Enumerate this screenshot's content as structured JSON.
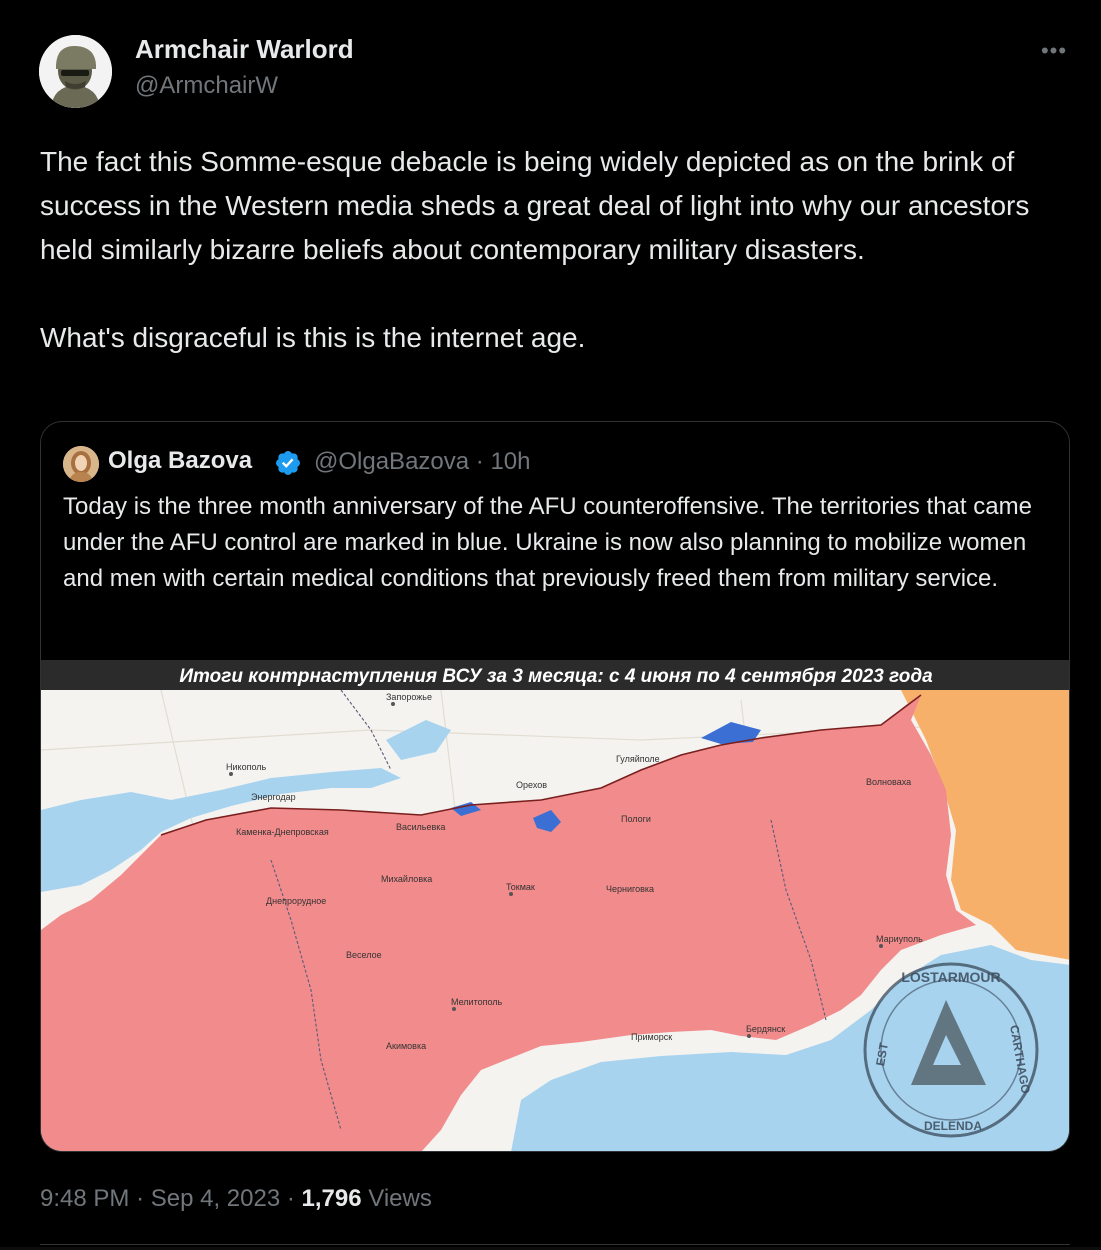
{
  "tweet": {
    "author_name": "Armchair Warlord",
    "author_handle": "@ArmchairW",
    "more_label": "•••",
    "paragraphs": [
      "The fact this Somme-esque debacle is being widely depicted as on the brink of success in the Western media sheds a great deal of light into why our ancestors held similarly bizarre beliefs about contemporary military disasters.",
      "What's disgraceful is this is the internet age."
    ],
    "time": "9:48 PM",
    "date": "Sep 4, 2023",
    "views_count": "1,796",
    "views_label": "Views",
    "sep": "·"
  },
  "quote": {
    "author_name": "Olga Bazova",
    "author_handle": "@OlgaBazova",
    "age": "10h",
    "text": "Today is the three month anniversary of the AFU counteroffensive. The territories that came under the AFU control are marked in blue. Ukraine is now also planning to mobilize women and men with certain medical conditions that previously freed them from military service.",
    "verified_color": "#1d9bf0"
  },
  "map": {
    "title": "Итоги контрнаступления ВСУ за 3 месяца: с 4 июня по 4 сентября 2023 года",
    "watermark_words": [
      "LOSTARMOUR",
      "CARTHAGO",
      "DELENDA",
      "EST"
    ],
    "cities": [
      "Запорожье",
      "Никополь",
      "Энергодар",
      "Васильевка",
      "Пологи",
      "Токмак",
      "Орехов",
      "Мелитополь",
      "Бердянск",
      "Мариуполь",
      "Волноваха",
      "Приморск",
      "Гуляйполе",
      "Каменка-Днепровская",
      "Михайловка",
      "Веселое",
      "Акимовка",
      "Днепрорудное",
      "Черниговка"
    ],
    "colors": {
      "russian": "#f28b8b",
      "ukrainian": "#3b6fd4",
      "dpr": "#f6b06a",
      "sea": "#a8d3ef",
      "land": "#f4f3ef"
    }
  }
}
